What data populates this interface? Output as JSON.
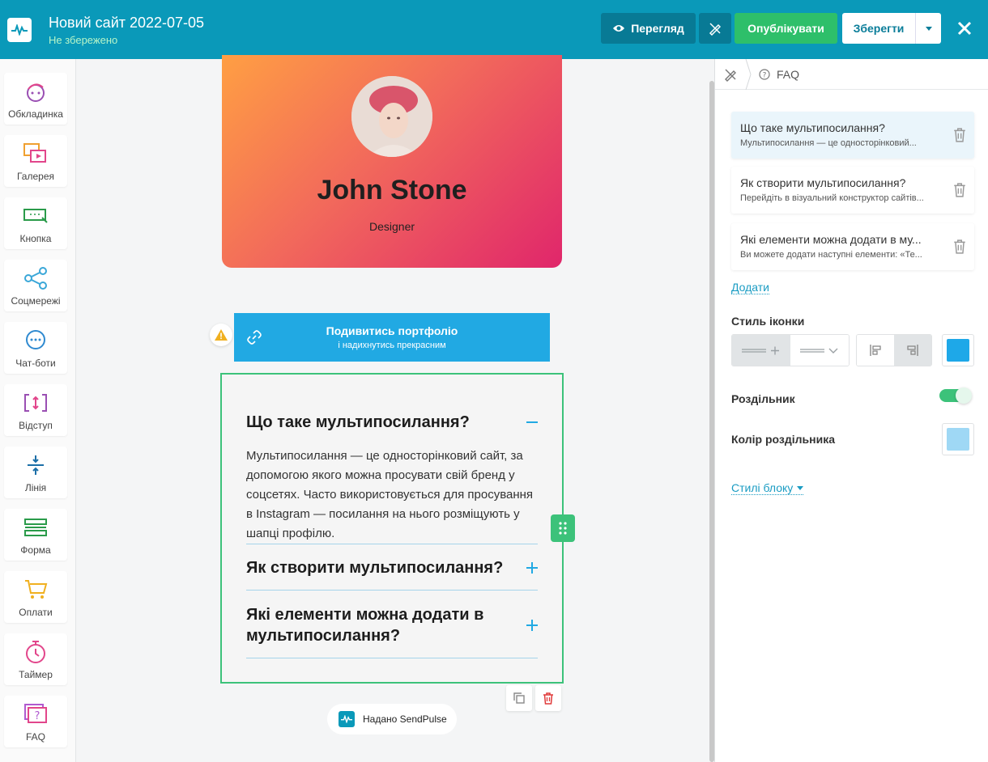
{
  "header": {
    "site_title": "Новий сайт 2022-07-05",
    "save_status": "Не збережено",
    "preview_label": "Перегляд",
    "publish_label": "Опублікувати",
    "save_label": "Зберегти",
    "bg_color": "#0a99b9"
  },
  "sidebar": {
    "items": [
      {
        "label": "Обкладинка",
        "icon": "cover-avatar-icon"
      },
      {
        "label": "Галерея",
        "icon": "gallery-icon"
      },
      {
        "label": "Кнопка",
        "icon": "button-icon"
      },
      {
        "label": "Соцмережі",
        "icon": "share-icon"
      },
      {
        "label": "Чат-боти",
        "icon": "chat-icon"
      },
      {
        "label": "Відступ",
        "icon": "spacing-icon"
      },
      {
        "label": "Лінія",
        "icon": "line-icon"
      },
      {
        "label": "Форма",
        "icon": "form-icon"
      },
      {
        "label": "Оплати",
        "icon": "cart-icon"
      },
      {
        "label": "Таймер",
        "icon": "timer-icon"
      },
      {
        "label": "FAQ",
        "icon": "faq-icon"
      }
    ]
  },
  "canvas": {
    "profile": {
      "name": "John Stone",
      "role": "Designer"
    },
    "portfolio_button": {
      "title": "Подивитись портфоліо",
      "subtitle": "і надихнутись прекрасним"
    },
    "faq": [
      {
        "question": "Що таке мультипосилання?",
        "answer": "Мультипосилання — це односторінковий сайт, за допомогою якого можна просувати свій бренд у соцсетях. Часто використовується для просування в Instagram — посилання на нього розміщують у шапці профілю.",
        "expanded": true
      },
      {
        "question": "Як створити мультипосилання?",
        "expanded": false
      },
      {
        "question": "Які елементи можна додати в мультипосилання?",
        "expanded": false
      }
    ],
    "branding": "Надано SendPulse"
  },
  "panel": {
    "breadcrumb": "FAQ",
    "items": [
      {
        "question": "Що таке мультипосилання?",
        "preview": "Мультипосилання — це односторінковий..."
      },
      {
        "question": "Як створити мультипосилання?",
        "preview": "Перейдіть в візуальний конструктор сайтів..."
      },
      {
        "question": "Які елементи можна додати в му...",
        "preview": "Ви можете додати наступні елементи: «Те..."
      }
    ],
    "add_label": "Додати",
    "icon_style_label": "Стиль іконки",
    "divider_label": "Роздільник",
    "divider_color_label": "Колір роздільника",
    "block_styles_label": "Стилі блоку",
    "icon_color": "#1ea8e8",
    "divider_color": "#9fd8f5",
    "divider_enabled": true
  }
}
